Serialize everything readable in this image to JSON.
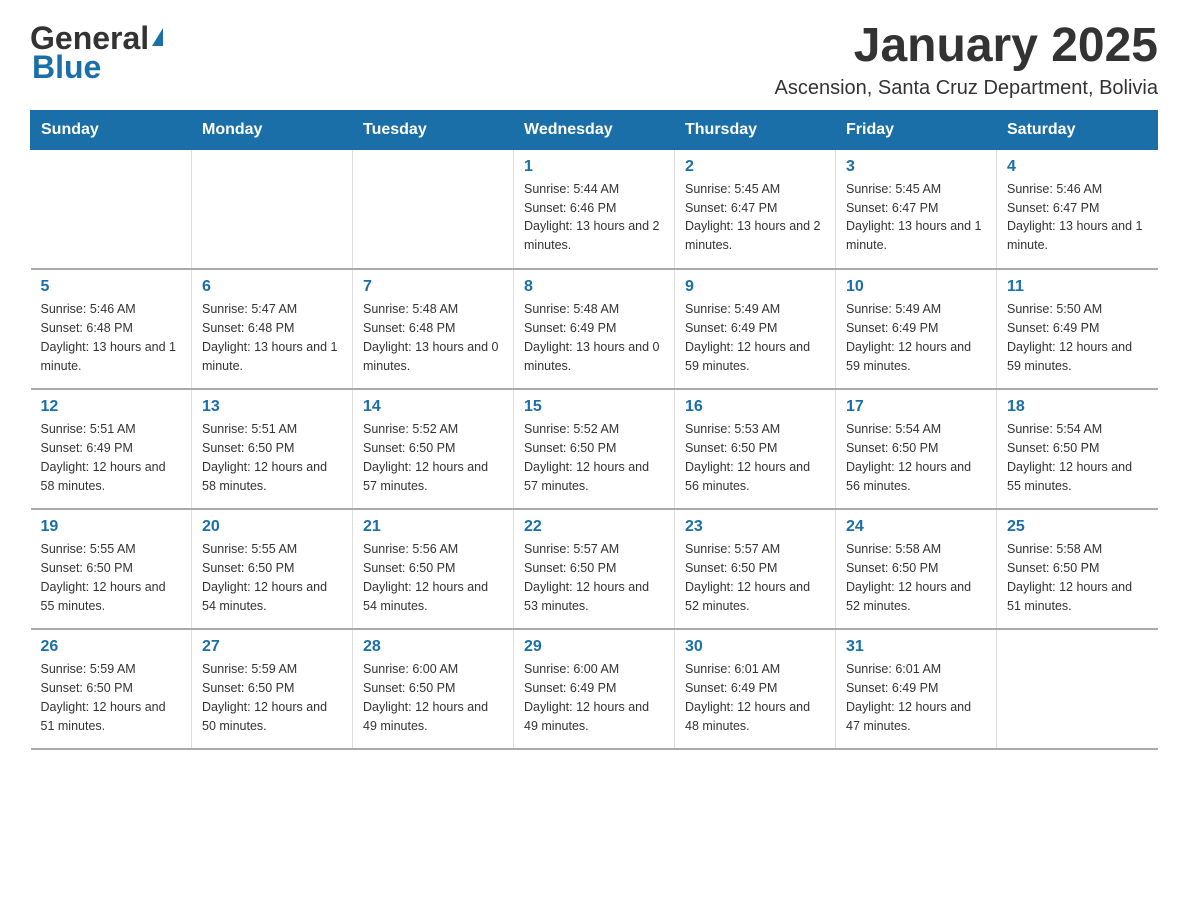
{
  "logo": {
    "text_general": "General",
    "text_blue": "Blue"
  },
  "title": "January 2025",
  "subtitle": "Ascension, Santa Cruz Department, Bolivia",
  "weekdays": [
    "Sunday",
    "Monday",
    "Tuesday",
    "Wednesday",
    "Thursday",
    "Friday",
    "Saturday"
  ],
  "weeks": [
    [
      {
        "day": "",
        "info": ""
      },
      {
        "day": "",
        "info": ""
      },
      {
        "day": "",
        "info": ""
      },
      {
        "day": "1",
        "info": "Sunrise: 5:44 AM\nSunset: 6:46 PM\nDaylight: 13 hours and 2 minutes."
      },
      {
        "day": "2",
        "info": "Sunrise: 5:45 AM\nSunset: 6:47 PM\nDaylight: 13 hours and 2 minutes."
      },
      {
        "day": "3",
        "info": "Sunrise: 5:45 AM\nSunset: 6:47 PM\nDaylight: 13 hours and 1 minute."
      },
      {
        "day": "4",
        "info": "Sunrise: 5:46 AM\nSunset: 6:47 PM\nDaylight: 13 hours and 1 minute."
      }
    ],
    [
      {
        "day": "5",
        "info": "Sunrise: 5:46 AM\nSunset: 6:48 PM\nDaylight: 13 hours and 1 minute."
      },
      {
        "day": "6",
        "info": "Sunrise: 5:47 AM\nSunset: 6:48 PM\nDaylight: 13 hours and 1 minute."
      },
      {
        "day": "7",
        "info": "Sunrise: 5:48 AM\nSunset: 6:48 PM\nDaylight: 13 hours and 0 minutes."
      },
      {
        "day": "8",
        "info": "Sunrise: 5:48 AM\nSunset: 6:49 PM\nDaylight: 13 hours and 0 minutes."
      },
      {
        "day": "9",
        "info": "Sunrise: 5:49 AM\nSunset: 6:49 PM\nDaylight: 12 hours and 59 minutes."
      },
      {
        "day": "10",
        "info": "Sunrise: 5:49 AM\nSunset: 6:49 PM\nDaylight: 12 hours and 59 minutes."
      },
      {
        "day": "11",
        "info": "Sunrise: 5:50 AM\nSunset: 6:49 PM\nDaylight: 12 hours and 59 minutes."
      }
    ],
    [
      {
        "day": "12",
        "info": "Sunrise: 5:51 AM\nSunset: 6:49 PM\nDaylight: 12 hours and 58 minutes."
      },
      {
        "day": "13",
        "info": "Sunrise: 5:51 AM\nSunset: 6:50 PM\nDaylight: 12 hours and 58 minutes."
      },
      {
        "day": "14",
        "info": "Sunrise: 5:52 AM\nSunset: 6:50 PM\nDaylight: 12 hours and 57 minutes."
      },
      {
        "day": "15",
        "info": "Sunrise: 5:52 AM\nSunset: 6:50 PM\nDaylight: 12 hours and 57 minutes."
      },
      {
        "day": "16",
        "info": "Sunrise: 5:53 AM\nSunset: 6:50 PM\nDaylight: 12 hours and 56 minutes."
      },
      {
        "day": "17",
        "info": "Sunrise: 5:54 AM\nSunset: 6:50 PM\nDaylight: 12 hours and 56 minutes."
      },
      {
        "day": "18",
        "info": "Sunrise: 5:54 AM\nSunset: 6:50 PM\nDaylight: 12 hours and 55 minutes."
      }
    ],
    [
      {
        "day": "19",
        "info": "Sunrise: 5:55 AM\nSunset: 6:50 PM\nDaylight: 12 hours and 55 minutes."
      },
      {
        "day": "20",
        "info": "Sunrise: 5:55 AM\nSunset: 6:50 PM\nDaylight: 12 hours and 54 minutes."
      },
      {
        "day": "21",
        "info": "Sunrise: 5:56 AM\nSunset: 6:50 PM\nDaylight: 12 hours and 54 minutes."
      },
      {
        "day": "22",
        "info": "Sunrise: 5:57 AM\nSunset: 6:50 PM\nDaylight: 12 hours and 53 minutes."
      },
      {
        "day": "23",
        "info": "Sunrise: 5:57 AM\nSunset: 6:50 PM\nDaylight: 12 hours and 52 minutes."
      },
      {
        "day": "24",
        "info": "Sunrise: 5:58 AM\nSunset: 6:50 PM\nDaylight: 12 hours and 52 minutes."
      },
      {
        "day": "25",
        "info": "Sunrise: 5:58 AM\nSunset: 6:50 PM\nDaylight: 12 hours and 51 minutes."
      }
    ],
    [
      {
        "day": "26",
        "info": "Sunrise: 5:59 AM\nSunset: 6:50 PM\nDaylight: 12 hours and 51 minutes."
      },
      {
        "day": "27",
        "info": "Sunrise: 5:59 AM\nSunset: 6:50 PM\nDaylight: 12 hours and 50 minutes."
      },
      {
        "day": "28",
        "info": "Sunrise: 6:00 AM\nSunset: 6:50 PM\nDaylight: 12 hours and 49 minutes."
      },
      {
        "day": "29",
        "info": "Sunrise: 6:00 AM\nSunset: 6:49 PM\nDaylight: 12 hours and 49 minutes."
      },
      {
        "day": "30",
        "info": "Sunrise: 6:01 AM\nSunset: 6:49 PM\nDaylight: 12 hours and 48 minutes."
      },
      {
        "day": "31",
        "info": "Sunrise: 6:01 AM\nSunset: 6:49 PM\nDaylight: 12 hours and 47 minutes."
      },
      {
        "day": "",
        "info": ""
      }
    ]
  ]
}
